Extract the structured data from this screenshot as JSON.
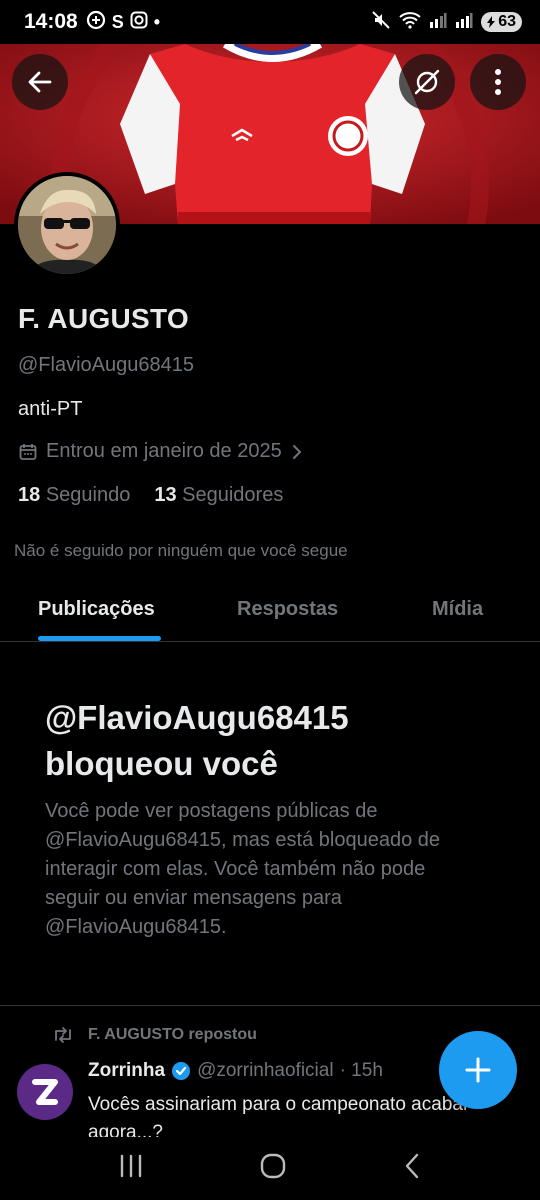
{
  "status_bar": {
    "time": "14:08",
    "left_icons": [
      "whatsapp-like-icon",
      "s-app-icon",
      "instagram-icon"
    ],
    "battery": "63"
  },
  "profile": {
    "display_name": "F. AUGUSTO",
    "handle": "@FlavioAugu68415",
    "bio": "anti-PT",
    "joined": "Entrou em janeiro de 2025",
    "following_count": "18",
    "following_label": "Seguindo",
    "followers_count": "13",
    "followers_label": "Seguidores",
    "not_followed_note": "Não é seguido por ninguém que você segue"
  },
  "tabs": [
    {
      "label": "Publicações",
      "active": true
    },
    {
      "label": "Respostas",
      "active": false
    },
    {
      "label": "Mídia",
      "active": false
    }
  ],
  "blocked": {
    "title": "@FlavioAugu68415 bloqueou você",
    "body": "Você pode ver postagens públicas de @FlavioAugu68415, mas está bloqueado de interagir com elas. Você também não pode seguir ou enviar mensagens para @FlavioAugu68415."
  },
  "post": {
    "repost_label": "F. AUGUSTO repostou",
    "author": "Zorrinha",
    "author_handle": "@zorrinhaoficial",
    "time": "· 15h",
    "text": "Vocês assinariam para o campeonato acabar agora...?"
  },
  "colors": {
    "accent": "#1d9bf0",
    "banner_red": "#b0141b",
    "muted": "#71767b",
    "text": "#e7e9ea"
  }
}
